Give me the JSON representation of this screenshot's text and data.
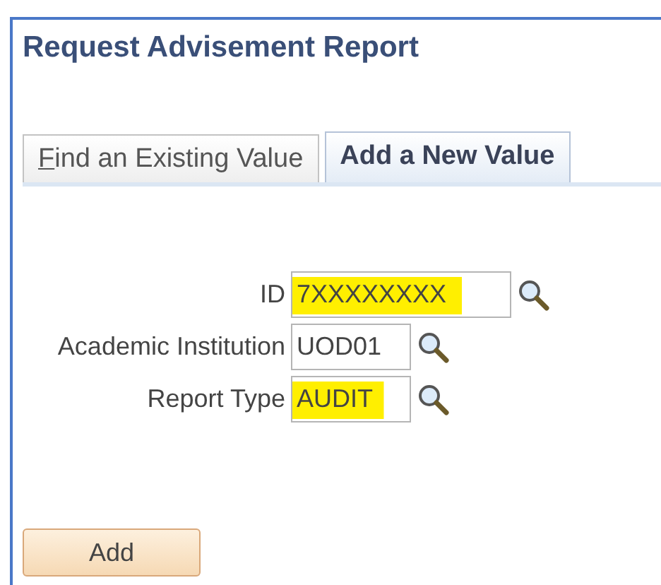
{
  "page": {
    "title": "Request Advisement Report"
  },
  "tabs": [
    {
      "label": "Find an Existing Value",
      "selected": false,
      "access_key_underlined": true
    },
    {
      "label": "Add a New Value",
      "selected": true,
      "access_key_underlined": false
    }
  ],
  "fields": [
    {
      "label": "ID",
      "value": "7XXXXXXXX",
      "highlighted": true,
      "kind": "wide"
    },
    {
      "label": "Academic Institution",
      "value": "UOD01",
      "highlighted": false,
      "kind": "short"
    },
    {
      "label": "Report Type",
      "value": "AUDIT",
      "highlighted": true,
      "kind": "short"
    }
  ],
  "buttons": [
    {
      "label": "Add"
    }
  ]
}
